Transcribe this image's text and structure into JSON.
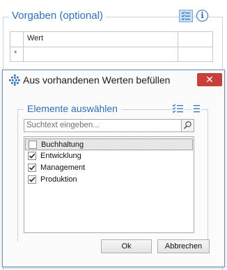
{
  "background": {
    "group_title": "Vorgaben (optional)",
    "grid": {
      "column_header": "Wert",
      "new_row_marker": "*"
    },
    "icons": [
      "list-edit-icon",
      "info-icon"
    ]
  },
  "dialog": {
    "title": "Aus vorhandenen Werten befüllen",
    "close_symbol": "✕",
    "group_title": "Elemente auswählen",
    "search_placeholder": "Suchtext eingeben...",
    "items": [
      {
        "label": "Buchhaltung",
        "checked": false,
        "focused": true
      },
      {
        "label": "Entwicklung",
        "checked": true,
        "focused": false
      },
      {
        "label": "Management",
        "checked": true,
        "focused": false
      },
      {
        "label": "Produktion",
        "checked": true,
        "focused": false
      }
    ],
    "ok_label": "Ok",
    "cancel_label": "Abbrechen"
  },
  "colors": {
    "accent": "#2e6fb6",
    "close": "#c7413a",
    "border": "#6e92bc"
  }
}
